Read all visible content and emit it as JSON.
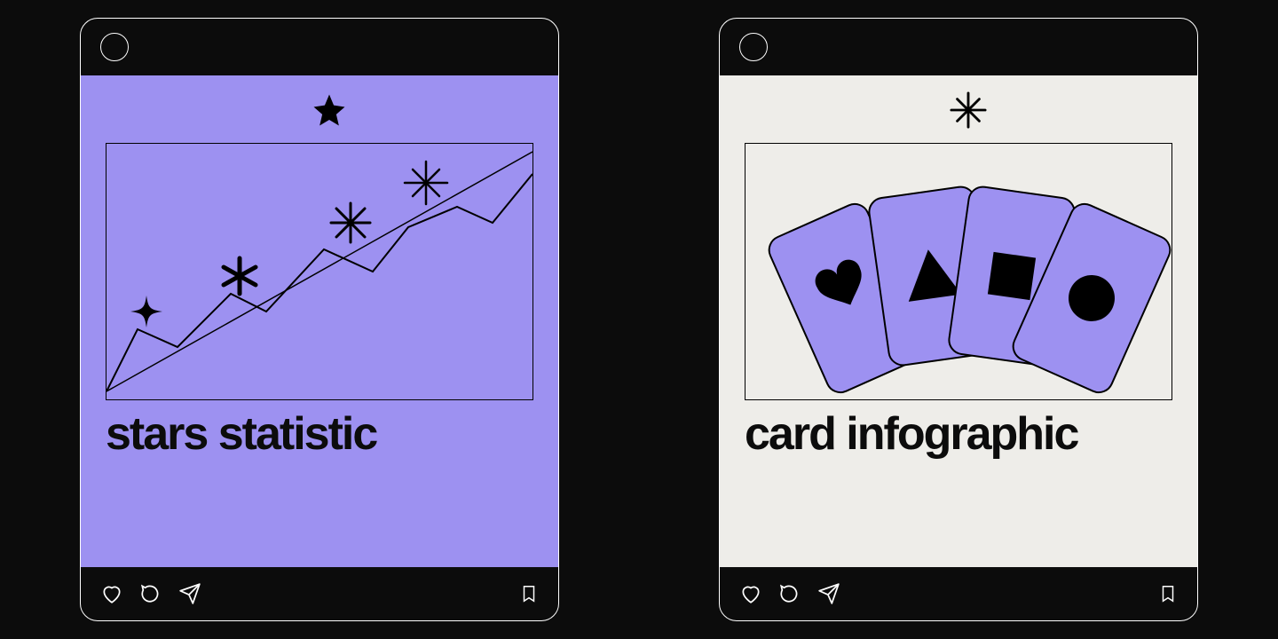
{
  "posts": {
    "left": {
      "title": "stars statistic",
      "logo_icon": "star-icon",
      "body_bg": "purple",
      "illustration": "line-chart-stars"
    },
    "right": {
      "title": "card infographic",
      "logo_icon": "sparkle-icon",
      "body_bg": "cream",
      "illustration": "card-fan"
    }
  },
  "footer_icons": [
    "heart-icon",
    "comment-icon",
    "send-icon",
    "bookmark-icon"
  ],
  "colors": {
    "purple": "#9d91f1",
    "cream": "#eeede9",
    "background": "#0c0c0c",
    "outline": "#ffffff"
  }
}
